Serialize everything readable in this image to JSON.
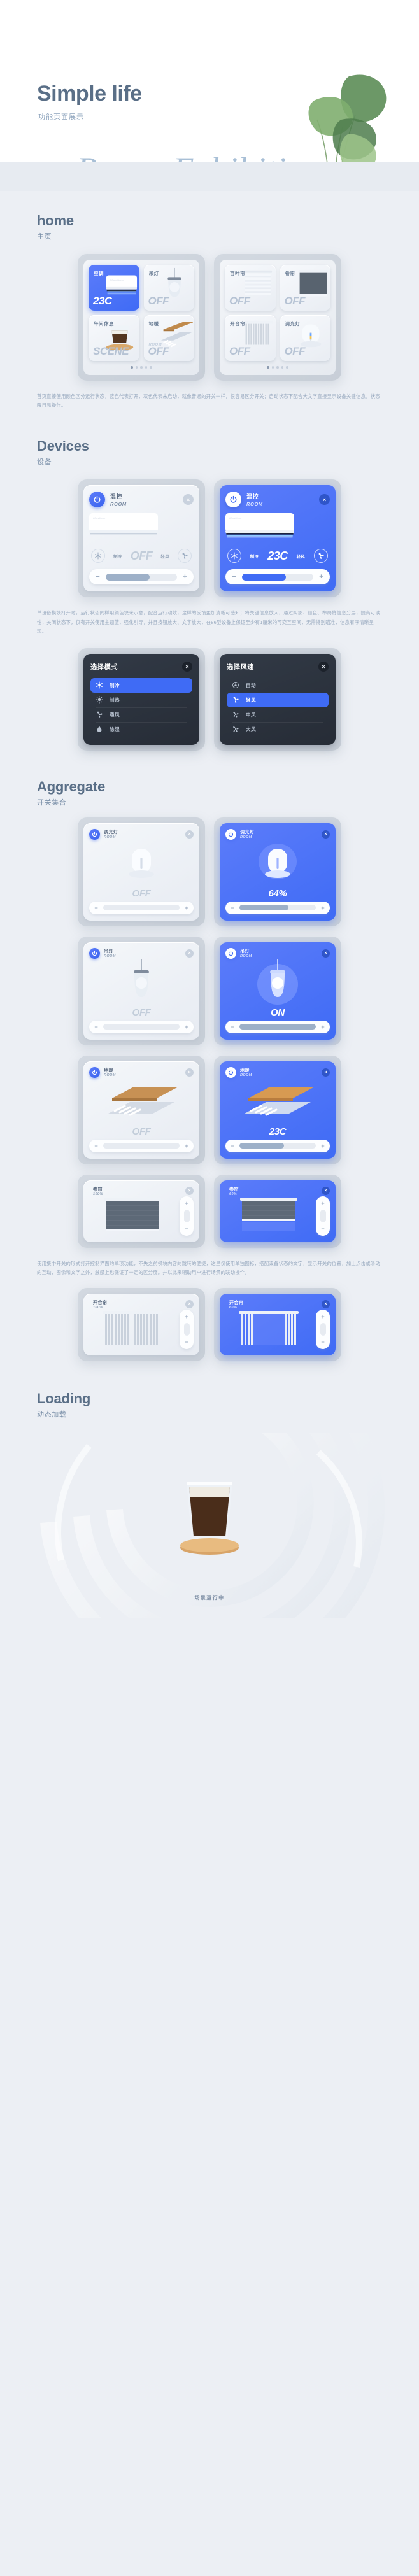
{
  "hero": {
    "title": "Simple life",
    "subtitle": "功能页面展示",
    "script": "Pages Exhibition"
  },
  "sections": {
    "home": {
      "en": "home",
      "cn": "主页",
      "description": "首页直接使用颜色区分运行状态，蓝色代表打开，灰色代表未启动，就像普通的开关一样，很容易区分开关；启动状态下配合大文字直接显示设备关键信息，状态醒目易操作。",
      "panel_left": {
        "tiles": [
          {
            "name": "空调",
            "state": "23C",
            "room": "",
            "on": true,
            "art": "air-conditioner"
          },
          {
            "name": "吊灯",
            "state": "OFF",
            "room": "",
            "on": false,
            "art": "pendant-lamp"
          },
          {
            "name": "午间休息",
            "state": "SCENE",
            "room": "",
            "on": false,
            "art": "coffee-glass"
          },
          {
            "name": "地暖",
            "state": "OFF",
            "room": "ROOM",
            "on": false,
            "art": "floor-heating"
          }
        ],
        "dots": 5,
        "active_dot": 0
      },
      "panel_right": {
        "tiles": [
          {
            "name": "百叶帘",
            "state": "OFF",
            "room": "",
            "on": false,
            "art": "venetian-blind"
          },
          {
            "name": "卷帘",
            "state": "OFF",
            "room": "",
            "on": false,
            "art": "roller-blind"
          },
          {
            "name": "开合帘",
            "state": "OFF",
            "room": "",
            "on": false,
            "art": "split-curtain"
          },
          {
            "name": "调光灯",
            "state": "OFF",
            "room": "",
            "on": false,
            "art": "dimmer-lamp"
          }
        ],
        "dots": 5,
        "active_dot": 0
      }
    },
    "devices": {
      "en": "Devices",
      "cn": "设备",
      "description": "单设备模块打开时，运行状态同样用颜色块来示意，配合运行动效，这样的反馈更加清晰可感知；将关键信息放大，通过阴影、颜色、布局将信息分层，提高可读性；关闭状态下，仅有开关使用主题蓝，强化引导，并且按钮放大、文字放大，在86型设备上保证至少有1厘米的可交互空间，无需特别瞄准，信息有序清晰呈现。",
      "card_off": {
        "title_cn": "温控",
        "title_en": "ROOM",
        "mode_label": "制冷",
        "fan_label": "轻风",
        "value": "OFF",
        "slider_percent": 62,
        "close": "×"
      },
      "card_on": {
        "title_cn": "温控",
        "title_en": "ROOM",
        "mode_label": "制冷",
        "fan_label": "轻风",
        "value": "23C",
        "slider_percent": 62,
        "close": "×"
      },
      "modal_mode": {
        "title": "选择模式",
        "close": "×",
        "options": [
          {
            "label": "制冷",
            "icon": "snowflake-icon",
            "selected": true
          },
          {
            "label": "制热",
            "icon": "sun-icon",
            "selected": false
          },
          {
            "label": "通风",
            "icon": "fan-icon",
            "selected": false
          },
          {
            "label": "除湿",
            "icon": "humidity-icon",
            "selected": false
          }
        ]
      },
      "modal_fan": {
        "title": "选择风速",
        "close": "×",
        "options": [
          {
            "label": "自动",
            "icon": "auto-icon",
            "selected": false
          },
          {
            "label": "轻风",
            "icon": "fan-low-icon",
            "selected": true
          },
          {
            "label": "中风",
            "icon": "fan-mid-icon",
            "selected": false
          },
          {
            "label": "大风",
            "icon": "fan-high-icon",
            "selected": false
          }
        ]
      }
    },
    "aggregate": {
      "en": "Aggregate",
      "cn": "开关集合",
      "description": "使用集中开关的形式打开控制界面的单项功能，不失之前模块内容的跳转的便捷，这里仅使用单独图标，搭配设备状态的文字，显示开关的位置，加上点击或滑动的互动，图像和文字之外，触感上也保证了一定的区分度。并以此来辅助用户进行场景的联动操作。",
      "rows": [
        {
          "off": {
            "title_cn": "调光灯",
            "title_en": "ROOM",
            "state": "OFF",
            "art": "dimmer-lamp",
            "slider_percent": 0,
            "close": "×"
          },
          "on": {
            "title_cn": "调光灯",
            "title_en": "ROOM",
            "state": "64%",
            "art": "dimmer-lamp",
            "slider_percent": 64,
            "close": "×"
          }
        },
        {
          "off": {
            "title_cn": "吊灯",
            "title_en": "ROOM",
            "state": "OFF",
            "art": "pendant-lamp",
            "slider_percent": 0,
            "close": "×"
          },
          "on": {
            "title_cn": "吊灯",
            "title_en": "ROOM",
            "state": "ON",
            "art": "pendant-lamp",
            "slider_percent": 100,
            "close": "×"
          }
        },
        {
          "off": {
            "title_cn": "地暖",
            "title_en": "ROOM",
            "state": "OFF",
            "art": "floor-heating",
            "slider_percent": 0,
            "close": "×"
          },
          "on": {
            "title_cn": "地暖",
            "title_en": "ROOM",
            "state": "23C",
            "art": "floor-heating",
            "slider_percent": 58,
            "close": "×"
          }
        },
        {
          "off": {
            "title_cn": "卷帘",
            "title_en": "100%",
            "state": "",
            "art": "roller-blind",
            "slider_percent": 0,
            "close": "×"
          },
          "on": {
            "title_cn": "卷帘",
            "title_en": "60%",
            "state": "",
            "art": "roller-blind",
            "slider_percent": 60,
            "close": "×"
          }
        },
        {
          "off": {
            "title_cn": "开合帘",
            "title_en": "100%",
            "state": "",
            "art": "split-curtain",
            "slider_percent": 0,
            "close": "×"
          },
          "on": {
            "title_cn": "开合帘",
            "title_en": "60%",
            "state": "",
            "art": "split-curtain",
            "slider_percent": 60,
            "close": "×"
          }
        }
      ]
    },
    "loading": {
      "en": "Loading",
      "cn": "动态加载",
      "caption": "场景运行中"
    }
  }
}
